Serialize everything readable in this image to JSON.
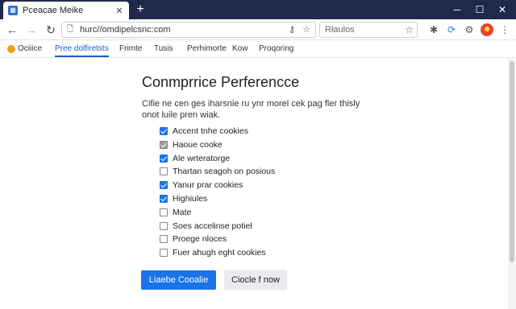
{
  "tab": {
    "title": "Pceacae Meike",
    "close": "✕"
  },
  "newtab": "+",
  "window": {
    "minimize": "─",
    "maximize": "☐",
    "close": "✕"
  },
  "nav": {
    "back": "←",
    "forward": "→",
    "reload": "↻"
  },
  "omnibox": {
    "url": "hurc//omdipelcsnc:com"
  },
  "searchbox": {
    "placeholder": "Rłaulos"
  },
  "bookmarks": {
    "items": [
      {
        "label": "Ociiice"
      },
      {
        "label": "Pree dolfiretsts"
      },
      {
        "label": "Frimte"
      },
      {
        "label": "Tusis"
      },
      {
        "label": "Perhimorte"
      },
      {
        "label": "Kow"
      },
      {
        "label": "Proqoring"
      }
    ],
    "active_index": 1
  },
  "page": {
    "heading": "Conmprrice Perferencce",
    "description": "Cifie ne cen ges iharsnie ru ynr morel cek pag fler thisly onot luile pren wiak."
  },
  "options": [
    {
      "label": "Accent tnhe cookies",
      "state": "checked"
    },
    {
      "label": "Haoue cooke",
      "state": "mixed"
    },
    {
      "label": "Ale wrteratorge",
      "state": "checked"
    },
    {
      "label": "Thartan seagoh on posious",
      "state": "unchecked"
    },
    {
      "label": "Yanur prar cookies",
      "state": "checked"
    },
    {
      "label": "Highiules",
      "state": "checked"
    },
    {
      "label": "Mate",
      "state": "unchecked"
    },
    {
      "label": "Soes accelinse potiel",
      "state": "unchecked"
    },
    {
      "label": "Proege nloces",
      "state": "unchecked"
    },
    {
      "label": "Fuer ahugh eght cookies",
      "state": "unchecked"
    }
  ],
  "buttons": {
    "primary": "Liaebe Cooalie",
    "secondary": "Ciocle f now"
  },
  "colors": {
    "tabstrip": "#1f2a4a",
    "accent": "#1a73e8",
    "secondary_button": "#e9ebee"
  },
  "icons": {
    "omnibox_actions": [
      "key-icon",
      "star-icon"
    ],
    "extensions": [
      "puzzle-icon",
      "sync-icon",
      "gear-icon",
      "profile-icon"
    ]
  }
}
